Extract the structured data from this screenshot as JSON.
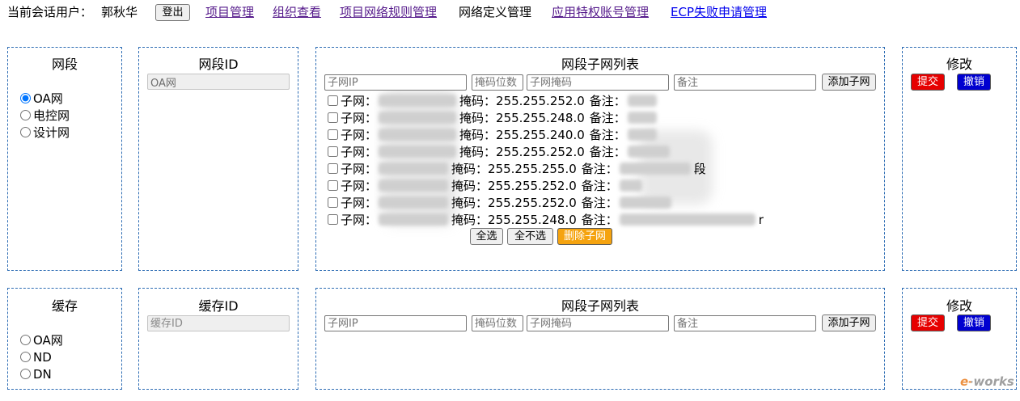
{
  "colors": {
    "panel_border": "#2e6db4",
    "visited_link": "#551a8b",
    "unvisited_link": "#0000ee",
    "delete_button": "#f5a30f",
    "submit_button": "#e60000",
    "cancel_button": "#0000d0",
    "radio_accent": "#0075ff"
  },
  "header": {
    "session_label": "当前会话用户：",
    "user_name": "郭秋华",
    "logout_label": "登出",
    "nav": [
      {
        "label": "项目管理"
      },
      {
        "label": "组织查看"
      },
      {
        "label": "项目网络规则管理"
      },
      {
        "label": "网络定义管理"
      },
      {
        "label": "应用特权账号管理"
      },
      {
        "label": "ECP失败申请管理"
      }
    ]
  },
  "segment": {
    "type_panel": {
      "title": "网段",
      "options": [
        {
          "label": "OA网",
          "checked": true
        },
        {
          "label": "电控网",
          "checked": false
        },
        {
          "label": "设计网",
          "checked": false
        }
      ]
    },
    "id_panel": {
      "title": "网段ID",
      "value": "OA网"
    },
    "subnet_panel": {
      "title": "网段子网列表",
      "ip_placeholder": "子网IP",
      "mask_bits_placeholder": "掩码位数",
      "mask_placeholder": "子网掩码",
      "note_placeholder": "备注",
      "add_label": "添加子网",
      "item_prefix": "子网：",
      "mask_label": "掩码：",
      "note_label": "备注：",
      "items": [
        {
          "mask": "255.255.252.0"
        },
        {
          "mask": "255.255.248.0"
        },
        {
          "mask": "255.255.240.0"
        },
        {
          "mask": "255.255.252.0"
        },
        {
          "mask": "255.255.255.0",
          "note_tail": "段"
        },
        {
          "mask": "255.255.252.0"
        },
        {
          "mask": "255.255.252.0"
        },
        {
          "mask": "255.255.248.0",
          "note_tail": "r"
        }
      ],
      "select_all_label": "全选",
      "select_none_label": "全不选",
      "delete_label": "删除子网"
    },
    "edit_panel": {
      "title": "修改",
      "submit_label": "提交",
      "cancel_label": "撤销"
    }
  },
  "cache": {
    "type_panel": {
      "title": "缓存",
      "options": [
        {
          "label": "OA网",
          "checked": false
        },
        {
          "label": "ND",
          "checked": false
        },
        {
          "label": "DN",
          "checked": false
        }
      ]
    },
    "id_panel": {
      "title": "缓存ID",
      "placeholder": "缓存ID"
    },
    "subnet_panel": {
      "title": "网段子网列表",
      "ip_placeholder": "子网IP",
      "mask_bits_placeholder": "掩码位数",
      "mask_placeholder": "子网掩码",
      "note_placeholder": "备注",
      "add_label": "添加子网"
    },
    "edit_panel": {
      "title": "修改",
      "submit_label": "提交",
      "cancel_label": "撤销"
    }
  },
  "watermark": "e-works"
}
